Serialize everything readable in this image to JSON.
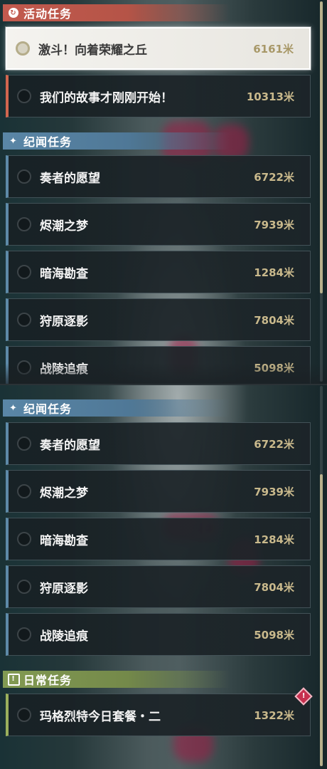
{
  "top_panel": {
    "event_section": {
      "title": "活动任务",
      "icon": "refresh-icon"
    },
    "event_quests": [
      {
        "name": "激斗！向着荣耀之丘",
        "distance": "6161米",
        "selected": true
      },
      {
        "name": "我们的故事才刚刚开始！",
        "distance": "10313米",
        "selected": false
      }
    ],
    "lore_section": {
      "title": "纪闻任务",
      "icon": "sparkle-icon"
    },
    "lore_quests": [
      {
        "name": "奏者的愿望",
        "distance": "6722米"
      },
      {
        "name": "烬潮之梦",
        "distance": "7939米"
      },
      {
        "name": "暗海勘查",
        "distance": "1284米"
      },
      {
        "name": "狩原逐影",
        "distance": "7804米"
      },
      {
        "name": "战陵追痕",
        "distance": "5098米"
      }
    ]
  },
  "bottom_panel": {
    "lore_section": {
      "title": "纪闻任务",
      "icon": "sparkle-icon"
    },
    "lore_quests": [
      {
        "name": "奏者的愿望",
        "distance": "6722米"
      },
      {
        "name": "烬潮之梦",
        "distance": "7939米"
      },
      {
        "name": "暗海勘查",
        "distance": "1284米"
      },
      {
        "name": "狩原逐影",
        "distance": "7804米"
      },
      {
        "name": "战陵追痕",
        "distance": "5098米"
      }
    ],
    "daily_section": {
      "title": "日常任务",
      "icon": "exclamation-box-icon"
    },
    "daily_quests": [
      {
        "name": "玛格烈特今日套餐・二",
        "distance": "1322米",
        "alert": "!"
      }
    ]
  },
  "colors": {
    "event_accent": "#c25a4e",
    "lore_accent": "#5a86a6",
    "daily_accent": "#829a52",
    "distance_text": "#c9b98c",
    "alert_badge": "#c7304f",
    "scroll_thumb": "#b7b08c"
  }
}
